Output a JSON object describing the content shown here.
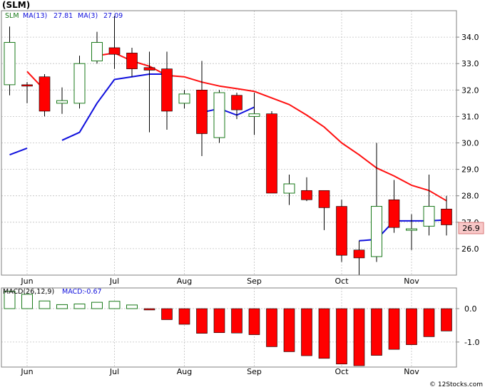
{
  "header": {
    "title": "(SLM)"
  },
  "watermark": "© 12Stocks.com",
  "colors": {
    "up": "#1a7a1a",
    "down": "#ff0000",
    "ma_long": "#ff1010",
    "ma_short": "#1010dd",
    "grid": "#c0c0c0",
    "frame": "#808080",
    "last_price_bg": "#f8c8c8"
  },
  "chart_data": [
    {
      "type": "candlestick",
      "legend": [
        {
          "label": "SLM",
          "value": ""
        },
        {
          "label": "MA(13)",
          "value": "27.81"
        },
        {
          "label": "MA(3)",
          "value": "27.09"
        }
      ],
      "y_ticks": [
        "26.0",
        "27.0",
        "28.0",
        "29.0",
        "30.0",
        "31.0",
        "32.0",
        "33.0",
        "34.0"
      ],
      "ylim": [
        25.0,
        35.0
      ],
      "x_tick_labels": [
        "Jun",
        "Jul",
        "Aug",
        "Sep",
        "Oct",
        "Nov"
      ],
      "x_tick_index": [
        1,
        6,
        10,
        14,
        19,
        23
      ],
      "last_price": "26.9",
      "candles": [
        {
          "o": 32.2,
          "h": 34.4,
          "l": 31.8,
          "c": 33.8
        },
        {
          "o": 32.2,
          "h": 32.3,
          "l": 31.5,
          "c": 32.15
        },
        {
          "o": 32.5,
          "h": 32.6,
          "l": 31.0,
          "c": 31.2
        },
        {
          "o": 31.5,
          "h": 32.1,
          "l": 31.1,
          "c": 31.6
        },
        {
          "o": 31.5,
          "h": 33.3,
          "l": 31.3,
          "c": 33.0
        },
        {
          "o": 33.1,
          "h": 34.2,
          "l": 33.0,
          "c": 33.8
        },
        {
          "o": 33.6,
          "h": 34.8,
          "l": 32.8,
          "c": 33.35
        },
        {
          "o": 33.4,
          "h": 33.6,
          "l": 32.5,
          "c": 32.8
        },
        {
          "o": 32.85,
          "h": 33.45,
          "l": 30.4,
          "c": 32.75
        },
        {
          "o": 32.8,
          "h": 33.45,
          "l": 30.5,
          "c": 31.2
        },
        {
          "o": 31.5,
          "h": 32.0,
          "l": 31.3,
          "c": 31.85
        },
        {
          "o": 32.0,
          "h": 33.1,
          "l": 29.5,
          "c": 30.35
        },
        {
          "o": 30.2,
          "h": 32.0,
          "l": 30.0,
          "c": 31.9
        },
        {
          "o": 31.8,
          "h": 31.9,
          "l": 30.9,
          "c": 31.25
        },
        {
          "o": 31.0,
          "h": 31.9,
          "l": 30.3,
          "c": 31.1
        },
        {
          "o": 31.1,
          "h": 31.2,
          "l": 28.1,
          "c": 28.1
        },
        {
          "o": 28.1,
          "h": 28.8,
          "l": 27.65,
          "c": 28.45
        },
        {
          "o": 28.2,
          "h": 28.7,
          "l": 27.8,
          "c": 27.85
        },
        {
          "o": 28.2,
          "h": 28.2,
          "l": 26.7,
          "c": 27.55
        },
        {
          "o": 27.6,
          "h": 27.85,
          "l": 25.5,
          "c": 25.75
        },
        {
          "o": 25.95,
          "h": 26.3,
          "l": 25.0,
          "c": 25.65
        },
        {
          "o": 25.7,
          "h": 30.0,
          "l": 25.5,
          "c": 27.6
        },
        {
          "o": 27.85,
          "h": 28.6,
          "l": 26.6,
          "c": 26.8
        },
        {
          "o": 26.7,
          "h": 27.3,
          "l": 25.95,
          "c": 26.75
        },
        {
          "o": 26.85,
          "h": 28.8,
          "l": 26.5,
          "c": 27.6
        },
        {
          "o": 27.5,
          "h": 28.0,
          "l": 26.5,
          "c": 26.9
        }
      ],
      "ma_long": [
        null,
        32.7,
        32.0,
        null,
        null,
        33.3,
        33.4,
        33.1,
        32.9,
        32.55,
        32.5,
        32.3,
        32.15,
        32.05,
        31.95,
        31.7,
        31.45,
        31.05,
        30.6,
        30.0,
        29.55,
        29.05,
        28.75,
        28.4,
        28.2,
        27.81
      ],
      "ma_short": [
        29.55,
        29.8,
        null,
        30.1,
        30.4,
        31.5,
        32.4,
        32.5,
        32.6,
        32.6,
        null,
        31.15,
        31.3,
        31.05,
        31.35,
        null,
        null,
        null,
        null,
        null,
        26.3,
        26.35,
        27.05,
        27.05,
        27.05,
        27.09
      ]
    },
    {
      "type": "bar",
      "legend": [
        {
          "label": "MACD(26,12,9)",
          "value": ""
        },
        {
          "label": "MACD:",
          "value": "-0.67"
        }
      ],
      "y_ticks": [
        "0.0",
        "-1.0"
      ],
      "ylim": [
        -1.75,
        0.62
      ],
      "x_tick_labels": [
        "Jun",
        "Jul",
        "Aug",
        "Sep",
        "Oct",
        "Nov"
      ],
      "values": [
        0.52,
        0.43,
        0.23,
        0.12,
        0.14,
        0.19,
        0.22,
        0.11,
        -0.04,
        -0.33,
        -0.47,
        -0.74,
        -0.72,
        -0.73,
        -0.78,
        -1.14,
        -1.29,
        -1.41,
        -1.49,
        -1.66,
        -1.71,
        -1.4,
        -1.22,
        -1.08,
        -0.84,
        -0.67
      ]
    }
  ]
}
